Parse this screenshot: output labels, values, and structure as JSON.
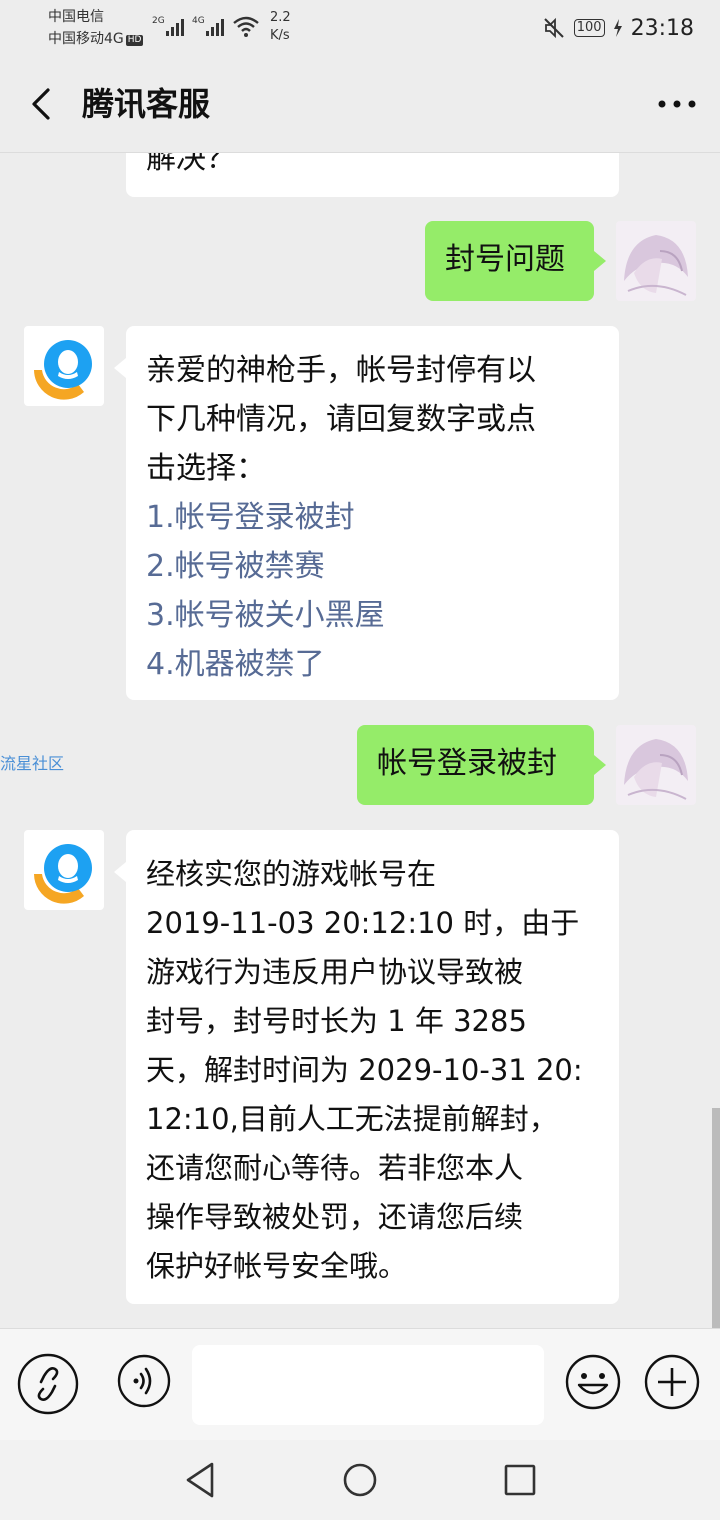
{
  "status_bar": {
    "carrier_1": "中国电信",
    "carrier_2": "中国移动4G",
    "hd_badge": "HD",
    "net_1": "2G",
    "net_2": "4G",
    "speed_value": "2.2",
    "speed_unit": "K/s",
    "battery": "100",
    "time": "23:18"
  },
  "header": {
    "title": "腾讯客服"
  },
  "messages": {
    "m0": {
      "text": "解决？"
    },
    "m1": {
      "text": "封号问题"
    },
    "m2": {
      "lines": [
        "亲爱的神枪手，帐号封停有以",
        "下几种情况，请回复数字或点",
        "击选择："
      ],
      "options": [
        "1.帐号登录被封",
        "2.帐号被禁赛",
        "3.帐号被关小黑屋",
        "4.机器被禁了"
      ]
    },
    "m3": {
      "text": "帐号登录被封"
    },
    "m4": {
      "lines": [
        "经核实您的游戏帐号在",
        "2019-11-03 20:12:10 时，由于",
        "游戏行为违反用户协议导致被",
        "封号，封号时长为 1 年 3285",
        "天，解封时间为 2029-10-31 20:",
        "12:10,目前人工无法提前解封，",
        "还请您耐心等待。若非您本人",
        "操作导致被处罚，还请您后续",
        "保护好帐号安全哦。"
      ]
    }
  },
  "watermark": "流星社区",
  "input_bar": {
    "text_value": ""
  },
  "colors": {
    "outgoing_bubble": "#95ec69",
    "link": "#576b95",
    "background": "#ededed"
  }
}
